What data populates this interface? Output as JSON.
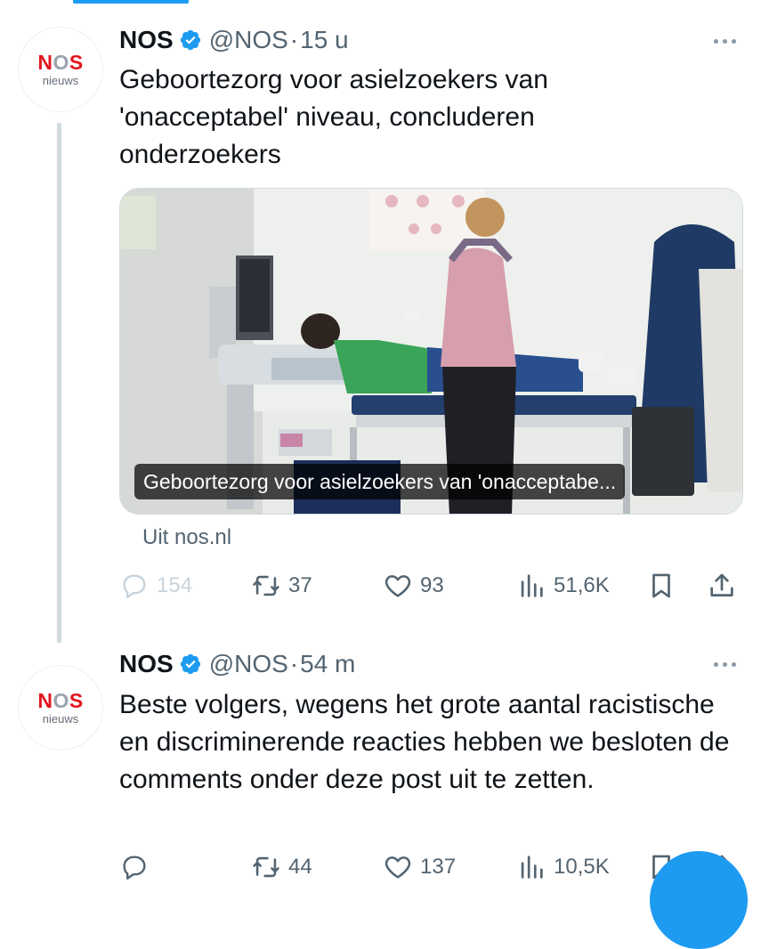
{
  "colors": {
    "accent": "#1d9bf0",
    "text": "#0f1419",
    "secondary": "#536471",
    "brand_red": "#e2151e"
  },
  "tweets": [
    {
      "author": {
        "name": "NOS",
        "handle": "@NOS",
        "avatar_logo": "NOS",
        "avatar_sub": "nieuws",
        "verified": true
      },
      "separator": "·",
      "time": "15 u",
      "text": "Geboortezorg voor asielzoekers van 'onacceptabel' niveau, concluderen onderzoekers",
      "media": {
        "caption": "Geboortezorg voor asielzoekers van 'onacceptabe...",
        "source": "Uit nos.nl"
      },
      "actions": {
        "replies": "154",
        "reposts": "37",
        "likes": "93",
        "views": "51,6K"
      }
    },
    {
      "author": {
        "name": "NOS",
        "handle": "@NOS",
        "avatar_logo": "NOS",
        "avatar_sub": "nieuws",
        "verified": true
      },
      "separator": "·",
      "time": "54 m",
      "text": "Beste volgers, wegens het grote aantal racistische en discriminerende reacties hebben we besloten de comments onder deze post uit te zetten.",
      "actions": {
        "replies": "",
        "reposts": "44",
        "likes": "137",
        "views": "10,5K"
      }
    }
  ],
  "icons": {
    "reply": "speech-bubble-icon",
    "repost": "repost-arrows-icon",
    "like": "heart-icon",
    "views": "bar-chart-icon",
    "bookmark": "bookmark-icon",
    "share": "share-upload-icon",
    "more": "three-dots-icon",
    "verified": "verified-badge-icon"
  }
}
